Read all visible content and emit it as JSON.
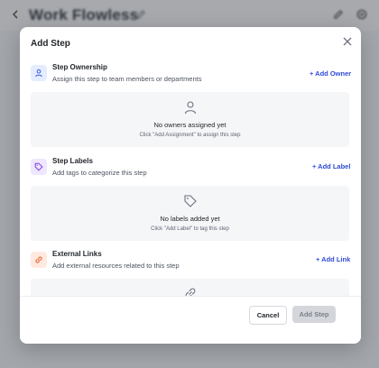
{
  "background": {
    "app_title": "Work Flowless"
  },
  "modal": {
    "title": "Add Step",
    "ownership": {
      "title": "Step Ownership",
      "subtitle": "Assign this step to team members or departments",
      "action": "+ Add Owner",
      "empty_title": "No owners assigned yet",
      "empty_hint": "Click \"Add Assignment\" to assign this step"
    },
    "labels": {
      "title": "Step Labels",
      "subtitle": "Add tags to categorize this step",
      "action": "+ Add Label",
      "empty_title": "No labels added yet",
      "empty_hint": "Click \"Add Label\" to tag this step"
    },
    "links": {
      "title": "External Links",
      "subtitle": "Add external resources related to this step",
      "action": "+ Add Link"
    },
    "footer": {
      "cancel": "Cancel",
      "submit": "Add Step"
    }
  },
  "colors": {
    "accent": "#2f4bd6",
    "ownership_icon_bg": "#e4ecff",
    "labels_icon_bg": "#efe6ff",
    "links_icon_bg": "#ffe9df"
  },
  "icons": {
    "close": "close-icon",
    "ownership": "user-icon",
    "labels": "tag-icon",
    "links": "link-icon"
  }
}
